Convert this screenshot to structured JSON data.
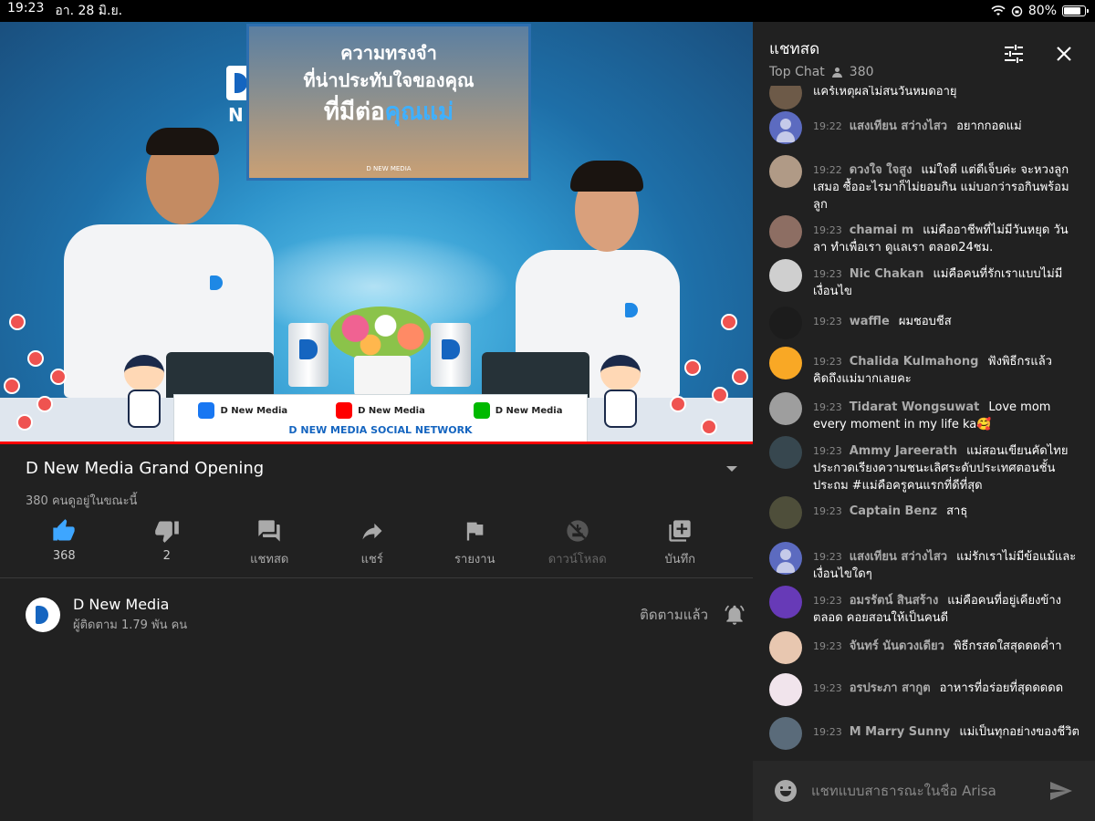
{
  "status": {
    "time": "19:23",
    "date": "อา. 28 มิ.ย.",
    "battery": "80%",
    "battery_level": 0.8
  },
  "video": {
    "corner_logo_text": "N",
    "poster": {
      "line1": "ความทรงจำ",
      "line2": "ที่น่าประทับใจของคุณ",
      "line3_a": "ที่มีต่อ",
      "line3_b": "คุณแม่",
      "brand": "D NEW MEDIA"
    },
    "banner": {
      "facebook": "D New Media",
      "youtube": "D New Media",
      "line": "D New Media",
      "network": "D NEW MEDIA SOCIAL NETWORK"
    }
  },
  "title": "D New Media Grand Opening",
  "viewers": "380 คนดูอยู่ในขณะนี้",
  "actions": [
    {
      "icon": "thumbs-up-icon",
      "label": "368"
    },
    {
      "icon": "thumbs-down-icon",
      "label": "2"
    },
    {
      "icon": "live-chat-icon",
      "label": "แชทสด"
    },
    {
      "icon": "share-icon",
      "label": "แชร์"
    },
    {
      "icon": "flag-icon",
      "label": "รายงาน"
    },
    {
      "icon": "download-off-icon",
      "label": "ดาวน์โหลด"
    },
    {
      "icon": "add-to-playlist-icon",
      "label": "บันทึก"
    }
  ],
  "channel": {
    "name": "D New Media",
    "subs": "ผู้ติดตาม 1.79 พัน คน",
    "subscribed_label": "ติดตามแล้ว"
  },
  "chat": {
    "title": "แชทสด",
    "mode": "Top Chat",
    "viewer_count": "380",
    "input_placeholder": "แชทแบบสาธารณะในชื่อ Arisa",
    "messages": [
      {
        "time": "",
        "author": "",
        "text": "แคร์เหตุผลไม่สนวันหมดอายุ",
        "avatar": "photo",
        "color": "#6d5a48"
      },
      {
        "time": "19:22",
        "author": "แสงเทียน สว่างไสว",
        "text": "อยากกอดแม่",
        "avatar": "default",
        "color": "#5c6bc0"
      },
      {
        "time": "19:22",
        "author": "ดวงใจ ใจสูง",
        "text": "แม่ใจดี แต่ดีเจ็บค่ะ จะหวงลูกเสมอ ซื้ออะไรมาก็ไม่ยอมกิน แม่บอกว่ารอกินพร้อมลูก",
        "avatar": "photo",
        "color": "#b09a86"
      },
      {
        "time": "19:23",
        "author": "chamai m",
        "text": "แม่คืออาชีพที่ไม่มีวันหยุด วันลา ทำเพื่อเรา ดูแลเรา ตลอด24ชม.",
        "avatar": "photo",
        "color": "#8d6e63"
      },
      {
        "time": "19:23",
        "author": "Nic Chakan",
        "text": "แม่คือคนที่รักเราแบบไม่มีเงื่อนไข",
        "avatar": "photo",
        "color": "#cfcfcf"
      },
      {
        "time": "19:23",
        "author": "waffle",
        "text": "ผมชอบชีส",
        "avatar": "photo",
        "color": "#1c1c1c"
      },
      {
        "time": "19:23",
        "author": "Chalida Kulmahong",
        "text": "ฟังพิธีกรแล้วคิดถึงแม่มากเลยคะ",
        "avatar": "photo",
        "color": "#f9a825"
      },
      {
        "time": "19:23",
        "author": "Tidarat Wongsuwat",
        "text": "Love mom every moment in my life ka🥰",
        "avatar": "photo",
        "color": "#9e9e9e"
      },
      {
        "time": "19:23",
        "author": "Ammy Jareerath",
        "text": "แม่สอนเขียนคัดไทย ประกวดเรียงความชนะเลิศระดับประเทศตอนชั้นประถม #แม่คือครูคนแรกที่ดีที่สุด",
        "avatar": "photo",
        "color": "#37474f"
      },
      {
        "time": "19:23",
        "author": "Captain Benz",
        "text": "สาธุ",
        "avatar": "photo",
        "color": "#4e4e3a"
      },
      {
        "time": "19:23",
        "author": "แสงเทียน สว่างไสว",
        "text": "แม่รักเราไม่มีข้อแม้และเงื่อนไขใดๆ",
        "avatar": "default",
        "color": "#5c6bc0"
      },
      {
        "time": "19:23",
        "author": "อมรรัตน์ สินสร้าง",
        "text": "แม่คือคนที่อยู่เคียงข้างตลอด คอยสอนให้เป็นคนดี",
        "avatar": "purple",
        "color": "#673ab7"
      },
      {
        "time": "19:23",
        "author": "จันทร์ นันดวงเดียว",
        "text": "พิธีกรสดใสสุดดดค่ำา",
        "avatar": "photo",
        "color": "#e8c7b0"
      },
      {
        "time": "19:23",
        "author": "อรประภา สากูต",
        "text": "อาหารที่อร่อยที่สุดดดดด",
        "avatar": "photo",
        "color": "#f1e4ec"
      },
      {
        "time": "19:23",
        "author": "M Marry Sunny",
        "text": "แม่เป็นทุกอย่างของชีวิต",
        "avatar": "photo",
        "color": "#5a6b7a"
      }
    ]
  }
}
